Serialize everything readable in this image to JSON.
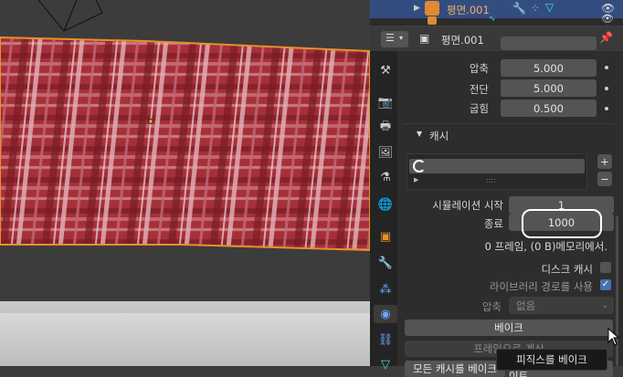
{
  "outliner": {
    "object_name": "평면.001",
    "sub_name": "평면"
  },
  "header": {
    "object_name": "평면.001"
  },
  "physics": {
    "compression_label": "압축",
    "compression_value": "5.000",
    "shear_label": "전단",
    "shear_value": "5.000",
    "bending_label": "굽힘",
    "bending_value": "0.500"
  },
  "cache": {
    "section_title": "캐시",
    "list_item_dots": "::::",
    "sim_start_label": "시뮬레이션 시작",
    "sim_start_value": "1",
    "end_label": "종료",
    "end_value": "1000",
    "info_text": "0 프레임, (0 B)메모리에서.",
    "disk_cache_label": "디스크 캐시",
    "library_path_label": "라이브러리 경로를 사용",
    "compression_label": "압축",
    "compression_value": "없음",
    "bake_button": "베이크",
    "calc_to_frame_button": "프레임으로 계산",
    "bake_all_button": "모든 캐시를 베이크",
    "update_all_button": "현재 캐시를 모두 업데이트"
  },
  "tooltip": {
    "text": "피직스를 베이크"
  },
  "colors": {
    "selection_outline": "#e8902a",
    "cloth_red": "#a6303a",
    "highlight_circle": "#ffffff",
    "checkbox_on": "#4772b3"
  },
  "icons": {
    "tabs": [
      "tool-icon",
      "render-icon",
      "output-icon",
      "view-layer-icon",
      "scene-icon",
      "world-icon",
      "object-icon",
      "modifier-icon",
      "particles-icon",
      "physics-icon",
      "constraints-icon",
      "data-icon"
    ]
  }
}
